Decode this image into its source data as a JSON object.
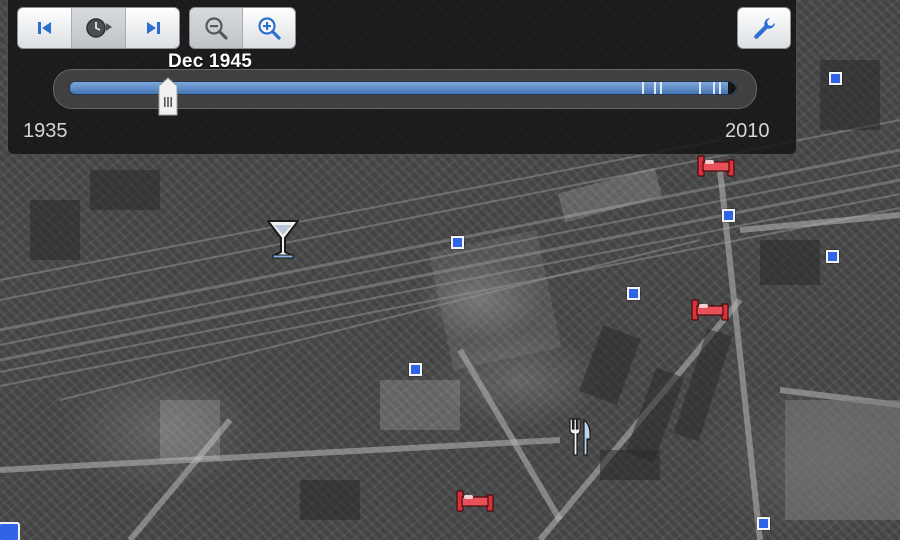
{
  "toolbar": {
    "buttons": [
      {
        "name": "previous-image",
        "icon": "skip-back-icon"
      },
      {
        "name": "play-animation",
        "icon": "clock-play-icon"
      },
      {
        "name": "next-image",
        "icon": "skip-forward-icon"
      },
      {
        "name": "zoom-out-time",
        "icon": "zoom-out-icon"
      },
      {
        "name": "zoom-in-time",
        "icon": "zoom-in-icon"
      },
      {
        "name": "settings",
        "icon": "wrench-icon"
      }
    ]
  },
  "time_slider": {
    "current_date": "Dec 1945",
    "start_year": "1935",
    "end_year": "2010",
    "position_fraction": 0.148,
    "accent_color": "#5a88c4"
  },
  "map": {
    "imagery": "historical aerial imagery (grayscale)",
    "markers": [
      {
        "type": "bar",
        "icon": "cocktail-glass-icon"
      },
      {
        "type": "restaurant",
        "icon": "fork-knife-icon"
      },
      {
        "type": "lodging",
        "icon": "bed-icon"
      },
      {
        "type": "lodging",
        "icon": "bed-icon"
      },
      {
        "type": "lodging",
        "icon": "bed-icon"
      },
      {
        "type": "place",
        "icon": "blue-square-icon"
      }
    ],
    "colors": {
      "lodging": "#e0323c",
      "place": "#2f63e8"
    }
  }
}
